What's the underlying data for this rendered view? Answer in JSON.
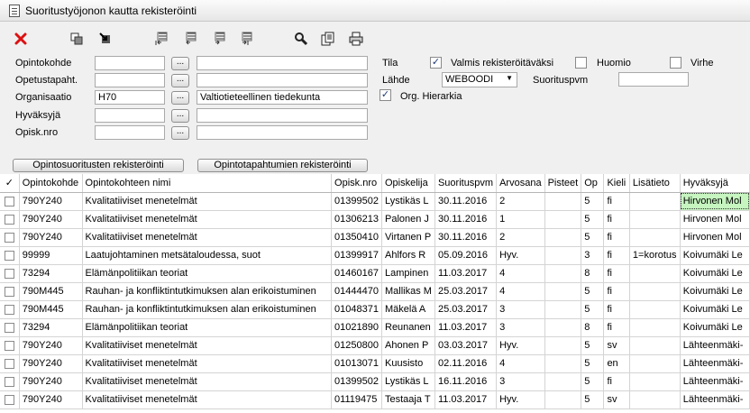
{
  "window": {
    "title": "Suoritustyöjonon kautta rekisteröinti"
  },
  "toolbar": {
    "buttons": [
      {
        "name": "delete-icon"
      },
      {
        "name": "copy-icon"
      },
      {
        "name": "move-icon"
      },
      {
        "name": "first-page-icon"
      },
      {
        "name": "previous-page-icon"
      },
      {
        "name": "next-page-icon"
      },
      {
        "name": "last-page-icon"
      },
      {
        "name": "search-icon"
      },
      {
        "name": "documents-icon"
      },
      {
        "name": "print-icon"
      }
    ]
  },
  "form": {
    "opintokohde": {
      "label": "Opintokohde",
      "code": "",
      "name": ""
    },
    "opetustapaht": {
      "label": "Opetustapaht.",
      "code": "",
      "name": ""
    },
    "organisaatio": {
      "label": "Organisaatio",
      "code": "H70",
      "name": "Valtiotieteellinen tiedekunta"
    },
    "hyvaksyja": {
      "label": "Hyväksyjä",
      "code": "",
      "name": ""
    },
    "opisknro": {
      "label": "Opisk.nro",
      "code": "",
      "name": ""
    },
    "dots_label": "...",
    "tila": {
      "label": "Tila",
      "valmis": {
        "label": "Valmis rekisteröitäväksi",
        "checked": true
      },
      "huomio": {
        "label": "Huomio",
        "checked": false
      },
      "virhe": {
        "label": "Virhe",
        "checked": false
      }
    },
    "lahde": {
      "label": "Lähde",
      "value": "WEBOODI"
    },
    "suorituspvm": {
      "label": "Suorituspvm",
      "value": ""
    },
    "org_hierarkia": {
      "label": "Org. Hierarkia",
      "checked": true
    }
  },
  "actions": {
    "opintosuoritusten": "Opintosuoritusten rekisteröinti",
    "opintotapahtumien": "Opintotapahtumien rekisteröinti"
  },
  "table": {
    "headers": {
      "check": "✓",
      "opintokohde": "Opintokohde",
      "nimi": "Opintokohteen nimi",
      "opisknro": "Opisk.nro",
      "opiskelija": "Opiskelija",
      "suorituspvm": "Suorituspvm",
      "arvosana": "Arvosana",
      "pisteet": "Pisteet",
      "op": "Op",
      "kieli": "Kieli",
      "lisatieto": "Lisätieto",
      "hyvaksyja": "Hyväksyjä"
    },
    "rows": [
      {
        "kohde": "790Y240",
        "nimi": "Kvalitatiiviset menetelmät",
        "nro": "01399502",
        "opiskelija": "Lystikäs L",
        "pvm": "30.11.2016",
        "arvosana": "2",
        "pisteet": "",
        "op": "5",
        "kieli": "fi",
        "lisatieto": "",
        "hyvaksyja": "Hirvonen Mol"
      },
      {
        "kohde": "790Y240",
        "nimi": "Kvalitatiiviset menetelmät",
        "nro": "01306213",
        "opiskelija": "Palonen J",
        "pvm": "30.11.2016",
        "arvosana": "1",
        "pisteet": "",
        "op": "5",
        "kieli": "fi",
        "lisatieto": "",
        "hyvaksyja": "Hirvonen Mol"
      },
      {
        "kohde": "790Y240",
        "nimi": "Kvalitatiiviset menetelmät",
        "nro": "01350410",
        "opiskelija": "Virtanen P",
        "pvm": "30.11.2016",
        "arvosana": "2",
        "pisteet": "",
        "op": "5",
        "kieli": "fi",
        "lisatieto": "",
        "hyvaksyja": "Hirvonen Mol"
      },
      {
        "kohde": "99999",
        "nimi": "Laatujohtaminen metsätaloudessa, suot",
        "nro": "01399917",
        "opiskelija": "Ahlfors R",
        "pvm": "05.09.2016",
        "arvosana": "Hyv.",
        "pisteet": "",
        "op": "3",
        "kieli": "fi",
        "lisatieto": "1=korotus",
        "hyvaksyja": "Koivumäki Le"
      },
      {
        "kohde": "73294",
        "nimi": "Elämänpolitiikan teoriat",
        "nro": "01460167",
        "opiskelija": "Lampinen",
        "pvm": "11.03.2017",
        "arvosana": "4",
        "pisteet": "",
        "op": "8",
        "kieli": "fi",
        "lisatieto": "",
        "hyvaksyja": "Koivumäki Le"
      },
      {
        "kohde": "790M445",
        "nimi": "Rauhan- ja konfliktintutkimuksen alan erikoistuminen",
        "nro": "01444470",
        "opiskelija": "Mallikas M",
        "pvm": "25.03.2017",
        "arvosana": "4",
        "pisteet": "",
        "op": "5",
        "kieli": "fi",
        "lisatieto": "",
        "hyvaksyja": "Koivumäki Le"
      },
      {
        "kohde": "790M445",
        "nimi": "Rauhan- ja konfliktintutkimuksen alan erikoistuminen",
        "nro": "01048371",
        "opiskelija": "Mäkelä A",
        "pvm": "25.03.2017",
        "arvosana": "3",
        "pisteet": "",
        "op": "5",
        "kieli": "fi",
        "lisatieto": "",
        "hyvaksyja": "Koivumäki Le"
      },
      {
        "kohde": "73294",
        "nimi": "Elämänpolitiikan teoriat",
        "nro": "01021890",
        "opiskelija": "Reunanen",
        "pvm": "11.03.2017",
        "arvosana": "3",
        "pisteet": "",
        "op": "8",
        "kieli": "fi",
        "lisatieto": "",
        "hyvaksyja": "Koivumäki Le"
      },
      {
        "kohde": "790Y240",
        "nimi": "Kvalitatiiviset menetelmät",
        "nro": "01250800",
        "opiskelija": "Ahonen P",
        "pvm": "03.03.2017",
        "arvosana": "Hyv.",
        "pisteet": "",
        "op": "5",
        "kieli": "sv",
        "lisatieto": "",
        "hyvaksyja": "Lähteenmäki-"
      },
      {
        "kohde": "790Y240",
        "nimi": "Kvalitatiiviset menetelmät",
        "nro": "01013071",
        "opiskelija": "Kuusisto",
        "pvm": "02.11.2016",
        "arvosana": "4",
        "pisteet": "",
        "op": "5",
        "kieli": "en",
        "lisatieto": "",
        "hyvaksyja": "Lähteenmäki-"
      },
      {
        "kohde": "790Y240",
        "nimi": "Kvalitatiiviset menetelmät",
        "nro": "01399502",
        "opiskelija": "Lystikäs L",
        "pvm": "16.11.2016",
        "arvosana": "3",
        "pisteet": "",
        "op": "5",
        "kieli": "fi",
        "lisatieto": "",
        "hyvaksyja": "Lähteenmäki-"
      },
      {
        "kohde": "790Y240",
        "nimi": "Kvalitatiiviset menetelmät",
        "nro": "01119475",
        "opiskelija": "Testaaja T",
        "pvm": "11.03.2017",
        "arvosana": "Hyv.",
        "pisteet": "",
        "op": "5",
        "kieli": "sv",
        "lisatieto": "",
        "hyvaksyja": "Lähteenmäki-"
      }
    ],
    "highlight_color": "#c6f5c0"
  }
}
